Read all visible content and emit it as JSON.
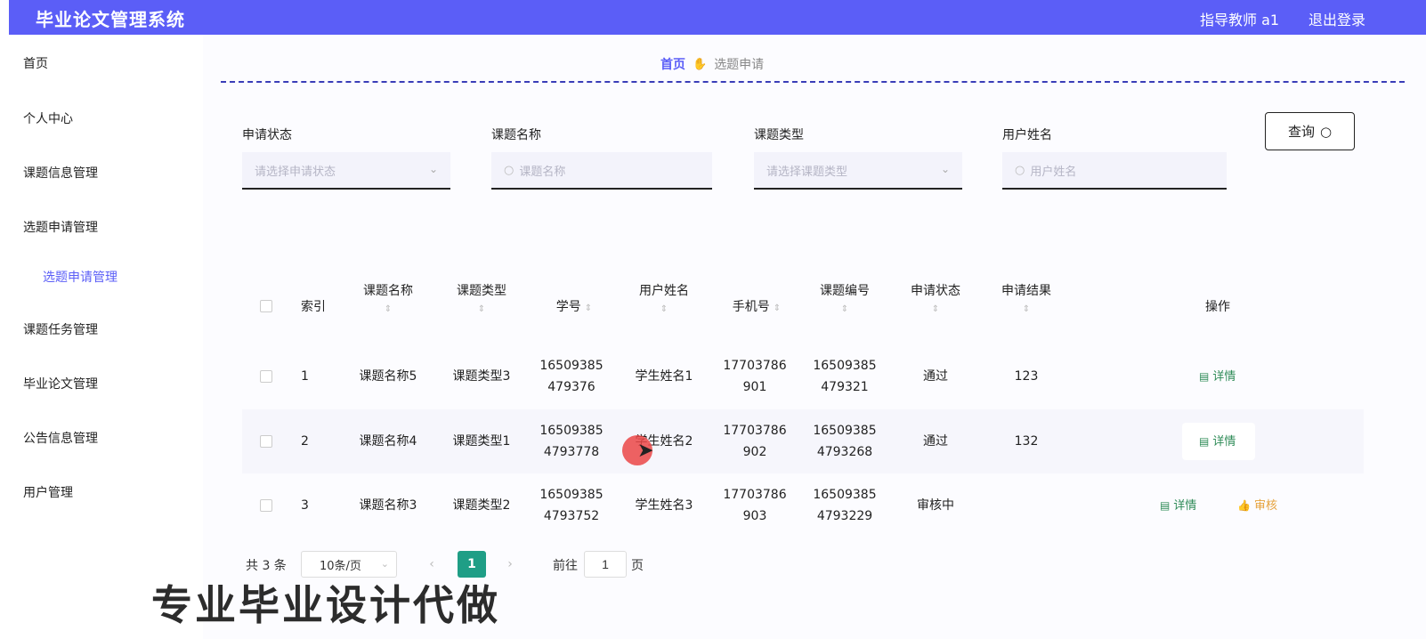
{
  "header": {
    "title": "毕业论文管理系统",
    "user": "指导教师 a1",
    "logout": "退出登录"
  },
  "sidebar": {
    "items": [
      {
        "label": "首页"
      },
      {
        "label": "个人中心"
      },
      {
        "label": "课题信息管理"
      },
      {
        "label": "选题申请管理"
      },
      {
        "label": "选题申请管理"
      },
      {
        "label": "课题任务管理"
      },
      {
        "label": "毕业论文管理"
      },
      {
        "label": "公告信息管理"
      },
      {
        "label": "用户管理"
      }
    ]
  },
  "breadcrumb": {
    "home": "首页",
    "current": "选题申请"
  },
  "filters": {
    "status": {
      "label": "申请状态",
      "placeholder": "请选择申请状态"
    },
    "name": {
      "label": "课题名称",
      "placeholder": "课题名称"
    },
    "type": {
      "label": "课题类型",
      "placeholder": "请选择课题类型"
    },
    "user": {
      "label": "用户姓名",
      "placeholder": "用户姓名"
    },
    "query_label": "查询"
  },
  "table": {
    "headers": {
      "index": "索引",
      "name": "课题名称",
      "type": "课题类型",
      "student_no": "学号",
      "user_name": "用户姓名",
      "phone": "手机号",
      "code": "课题编号",
      "status": "申请状态",
      "result": "申请结果",
      "actions": "操作"
    },
    "rows": [
      {
        "index": "1",
        "name": "课题名称5",
        "type": "课题类型3",
        "no1": "16509385",
        "no2": "479376",
        "user": "学生姓名1",
        "ph1": "17703786",
        "ph2": "901",
        "c1": "16509385",
        "c2": "479321",
        "status": "通过",
        "result": "123",
        "detail": "详情"
      },
      {
        "index": "2",
        "name": "课题名称4",
        "type": "课题类型1",
        "no1": "16509385",
        "no2": "4793778",
        "user": "学生姓名2",
        "ph1": "17703786",
        "ph2": "902",
        "c1": "16509385",
        "c2": "4793268",
        "status": "通过",
        "result": "132",
        "detail": "详情"
      },
      {
        "index": "3",
        "name": "课题名称3",
        "type": "课题类型2",
        "no1": "16509385",
        "no2": "4793752",
        "user": "学生姓名3",
        "ph1": "17703786",
        "ph2": "903",
        "c1": "16509385",
        "c2": "4793229",
        "status": "审核中",
        "result": "",
        "detail": "详情",
        "audit": "审核"
      }
    ]
  },
  "pagination": {
    "total": "共 3 条",
    "page_size": "10条/页",
    "current_page": "1",
    "goto_prefix": "前往",
    "goto_value": "1",
    "goto_suffix": "页"
  },
  "watermark": "专业毕业设计代做"
}
